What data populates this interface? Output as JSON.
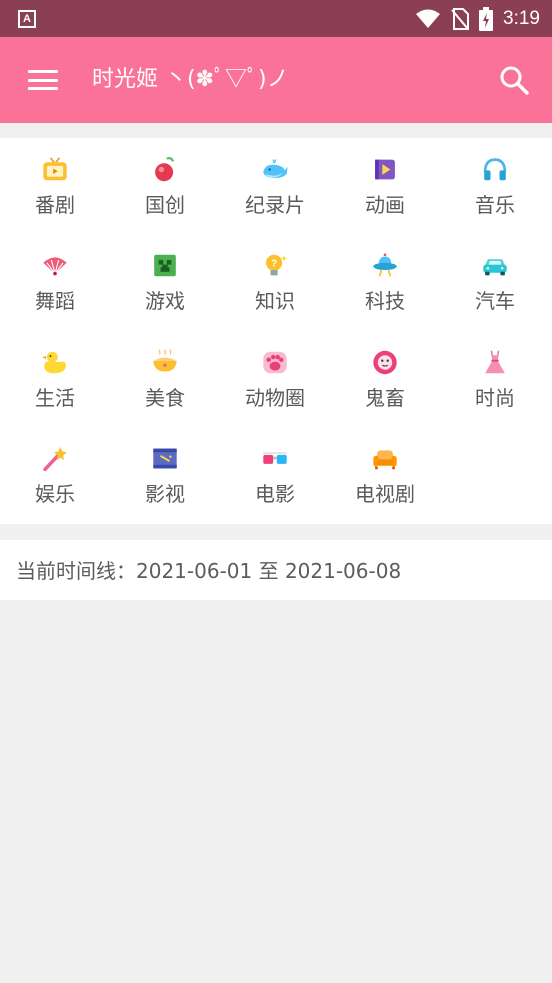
{
  "status_bar": {
    "app_icon_letter": "A",
    "time": "3:19"
  },
  "toolbar": {
    "title": "时光姬 丶(✽ﾟ▽ﾟ)ノ"
  },
  "categories": [
    {
      "label": "番剧",
      "icon": "tv-icon"
    },
    {
      "label": "国创",
      "icon": "peach-icon"
    },
    {
      "label": "纪录片",
      "icon": "whale-icon"
    },
    {
      "label": "动画",
      "icon": "play-icon"
    },
    {
      "label": "音乐",
      "icon": "headphones-icon"
    },
    {
      "label": "舞蹈",
      "icon": "fan-icon"
    },
    {
      "label": "游戏",
      "icon": "creeper-icon"
    },
    {
      "label": "知识",
      "icon": "lightbulb-icon"
    },
    {
      "label": "科技",
      "icon": "ufo-icon"
    },
    {
      "label": "汽车",
      "icon": "car-icon"
    },
    {
      "label": "生活",
      "icon": "duck-icon"
    },
    {
      "label": "美食",
      "icon": "bowl-icon"
    },
    {
      "label": "动物圈",
      "icon": "paw-icon"
    },
    {
      "label": "鬼畜",
      "icon": "lion-icon"
    },
    {
      "label": "时尚",
      "icon": "dress-icon"
    },
    {
      "label": "娱乐",
      "icon": "magic-wand-icon"
    },
    {
      "label": "影视",
      "icon": "film-icon"
    },
    {
      "label": "电影",
      "icon": "3d-glasses-icon"
    },
    {
      "label": "电视剧",
      "icon": "sofa-icon"
    }
  ],
  "timeline": {
    "text": "当前时间线：2021-06-01 至 2021-06-08"
  }
}
